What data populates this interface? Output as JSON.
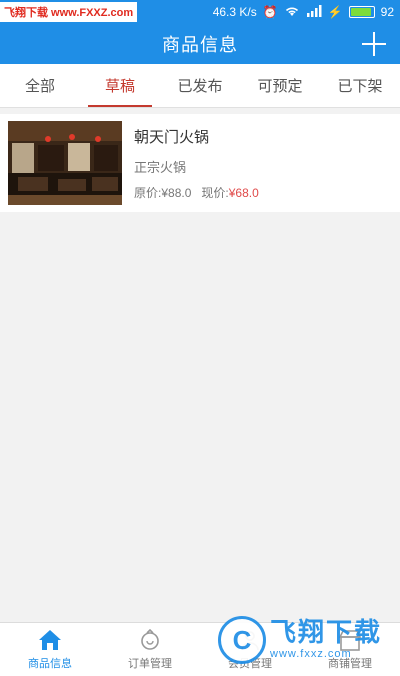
{
  "status_bar": {
    "watermark": "飞翔下载 www.FXXZ.com",
    "network": "46.3 K/s",
    "battery": "92",
    "battery_level": 0.92
  },
  "header": {
    "title": "商品信息",
    "add_icon": "plus-icon"
  },
  "tabs": [
    {
      "label": "全部",
      "active": false
    },
    {
      "label": "草稿",
      "active": true
    },
    {
      "label": "已发布",
      "active": false
    },
    {
      "label": "可预定",
      "active": false
    },
    {
      "label": "已下架",
      "active": false
    }
  ],
  "products": [
    {
      "name": "朝天门火锅",
      "description": "正宗火锅",
      "original_price_label": "原价:",
      "original_price": "¥88.0",
      "current_price_label": "现价:",
      "current_price": "¥68.0"
    }
  ],
  "bottom_nav": [
    {
      "label": "商品信息",
      "icon": "home-icon",
      "active": true
    },
    {
      "label": "订单管理",
      "icon": "order-icon",
      "active": false
    },
    {
      "label": "会员管理",
      "icon": "member-icon",
      "active": false
    },
    {
      "label": "商铺管理",
      "icon": "shop-icon",
      "active": false
    }
  ],
  "watermark_bottom": {
    "text": "飞翔下载",
    "url": "www.fxxz.com"
  },
  "colors": {
    "primary": "#1f8ee6",
    "accent": "#c43a2f",
    "price_now": "#e04a4a"
  }
}
